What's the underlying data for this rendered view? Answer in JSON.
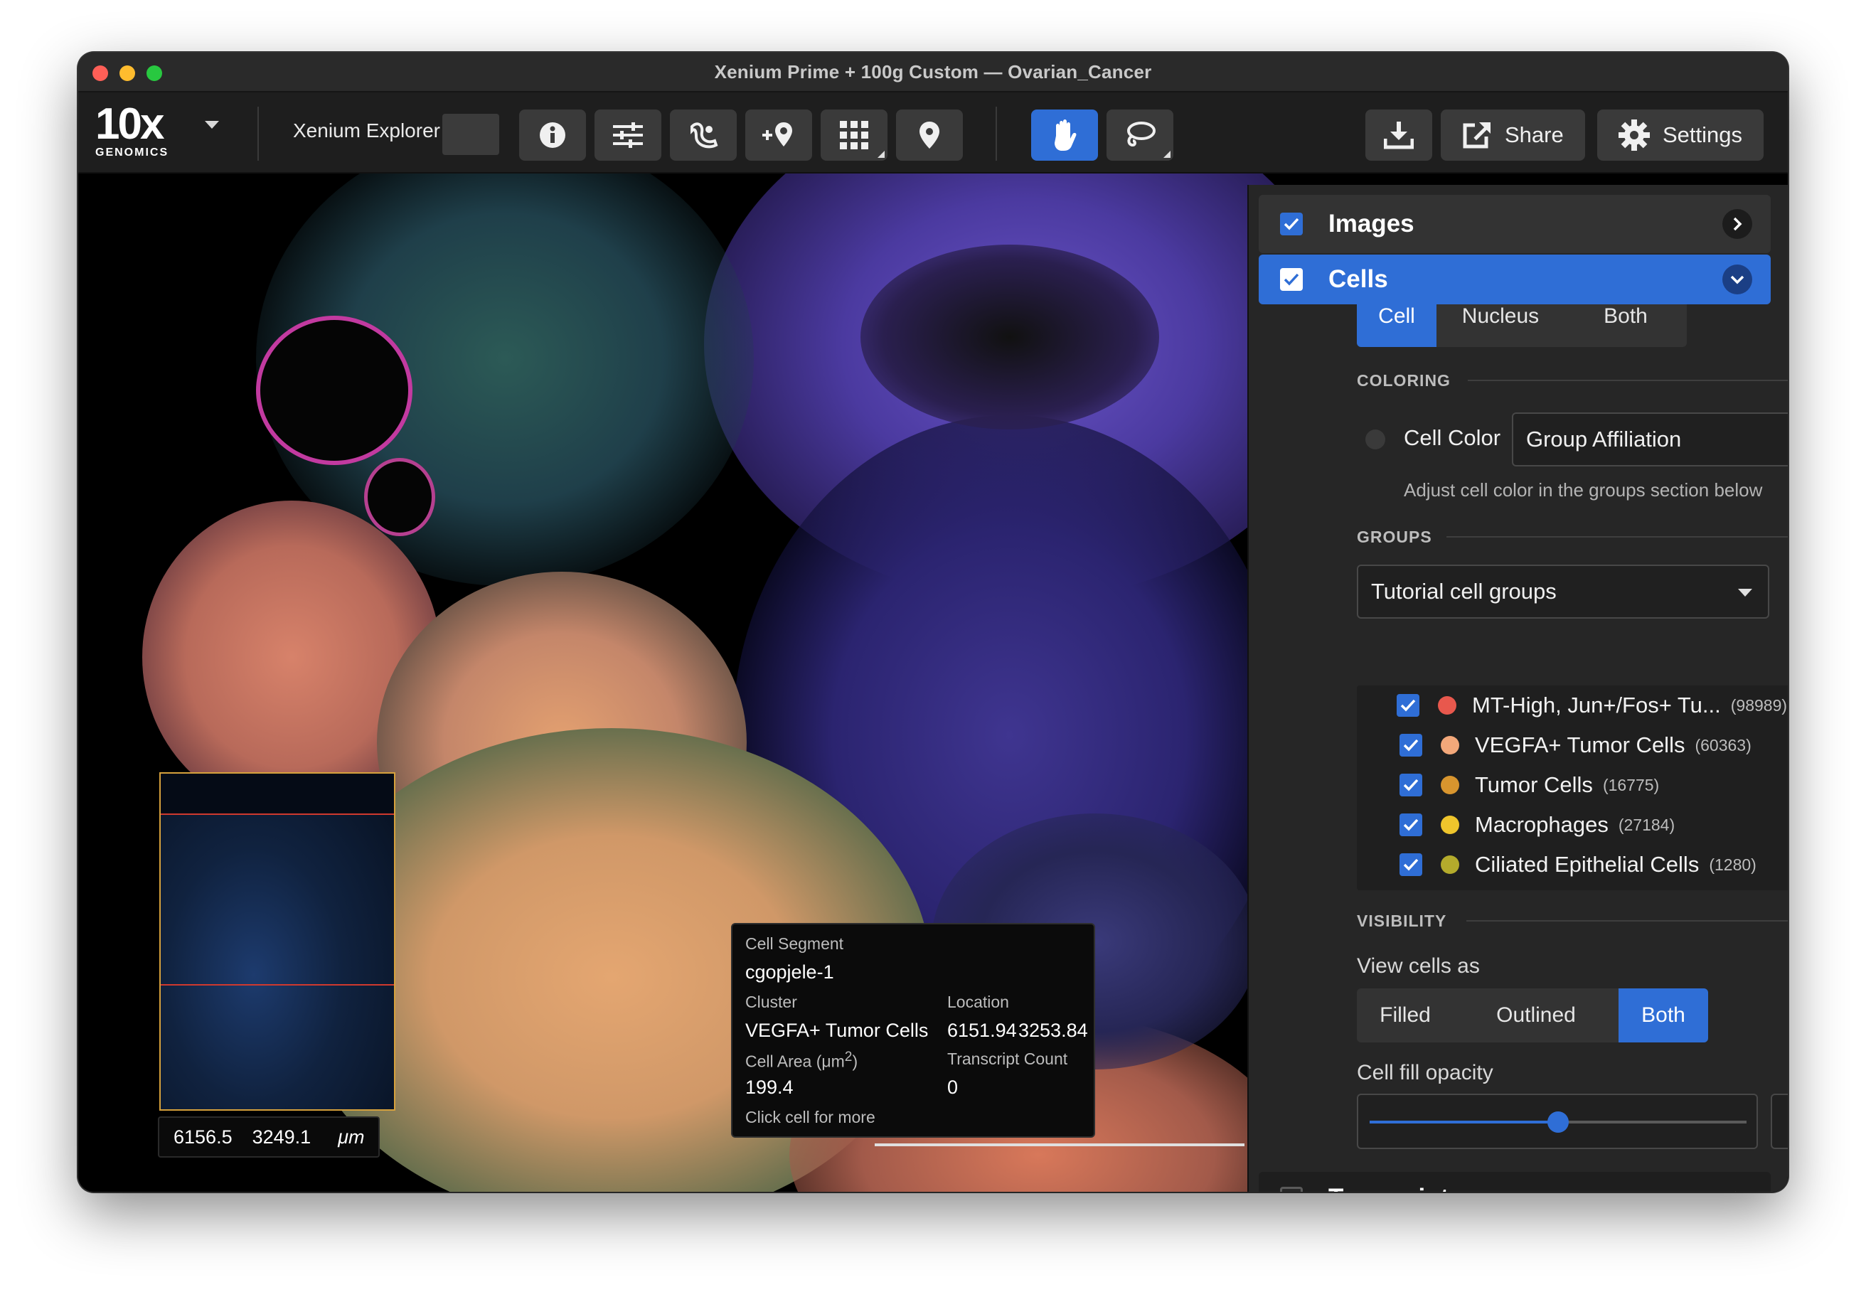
{
  "window": {
    "title": "Xenium Prime + 100g Custom — Ovarian_Cancer"
  },
  "toolbar": {
    "logo_main": "10x",
    "logo_sub": "GENOMICS",
    "project_label": "Xenium Explorer",
    "share_label": "Share",
    "settings_label": "Settings",
    "icons": [
      "info-icon",
      "sliders-icon",
      "gene-panel-icon",
      "add-location-icon",
      "grid-icon",
      "pin-icon",
      "hand-icon",
      "lasso-icon",
      "download-icon",
      "share-icon",
      "gear-icon"
    ]
  },
  "viewer": {
    "coord_x": "6156.5",
    "coord_y": "3249.1",
    "coord_unit": "μm"
  },
  "tooltip": {
    "segment_label": "Cell Segment",
    "segment_value": "cgopjele-1",
    "cluster_label": "Cluster",
    "cluster_value": "VEGFA+ Tumor Cells",
    "location_label": "Location",
    "location_x": "6151.94",
    "location_y": "3253.84",
    "area_label": "Cell Area (μm",
    "area_sup": "2",
    "area_close": ")",
    "area_value": "199.4",
    "transcript_label": "Transcript Count",
    "transcript_value": "0",
    "footer": "Click cell for more"
  },
  "panel": {
    "images": {
      "title": "Images",
      "checked": true
    },
    "cells": {
      "title": "Cells",
      "checked": true,
      "seg_tabs": [
        "Cell",
        "Nucleus",
        "Both"
      ],
      "seg_selected": "Cell",
      "coloring_label": "COLORING",
      "cell_color_label": "Cell Color",
      "cell_color_value": "Group Affiliation",
      "coloring_hint": "Adjust cell color in the groups section below",
      "groups_label": "GROUPS",
      "groups_select": "Tutorial cell groups",
      "groups": [
        {
          "name": "MT-High, Jun+/Fos+ Tu...",
          "count": "(98989)",
          "color": "#e8584d"
        },
        {
          "name": "VEGFA+ Tumor Cells",
          "count": "(60363)",
          "color": "#f3a87a"
        },
        {
          "name": "Tumor Cells",
          "count": "(16775)",
          "color": "#d8952e"
        },
        {
          "name": "Macrophages",
          "count": "(27184)",
          "color": "#efc52c"
        },
        {
          "name": "Ciliated Epithelial Cells",
          "count": "(1280)",
          "color": "#b4ab2c"
        }
      ],
      "visibility_label": "VISIBILITY",
      "view_as_label": "View cells as",
      "view_as_options": [
        "Filled",
        "Outlined",
        "Both"
      ],
      "view_as_selected": "Both",
      "opacity_label": "Cell fill opacity",
      "opacity_value": "50",
      "opacity_fraction": 0.5
    },
    "transcripts": {
      "title": "Transcripts",
      "checked": false
    }
  }
}
